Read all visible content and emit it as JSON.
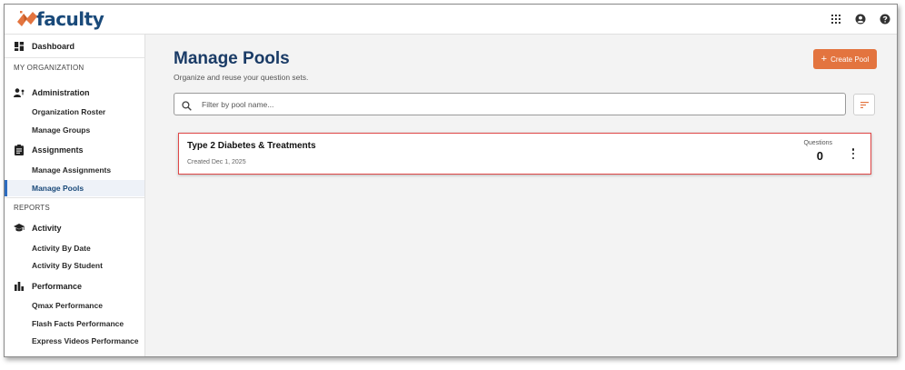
{
  "app": {
    "logo_text": "faculty"
  },
  "topbar": {
    "icons": [
      "apps-grid-icon",
      "account-circle-icon",
      "help-icon"
    ]
  },
  "sidebar": {
    "dashboard": "Dashboard",
    "my_org_section": "MY ORGANIZATION",
    "administration": "Administration",
    "admin_items": [
      "Organization Roster",
      "Manage Groups"
    ],
    "assignments": "Assignments",
    "assignment_items": [
      "Manage Assignments",
      "Manage Pools"
    ],
    "reports_section": "REPORTS",
    "activity": "Activity",
    "activity_items": [
      "Activity By Date",
      "Activity By Student"
    ],
    "performance": "Performance",
    "performance_items": [
      "Qmax Performance",
      "Flash Facts Performance",
      "Express Videos Performance"
    ]
  },
  "main": {
    "title": "Manage Pools",
    "subtitle": "Organize and reuse your question sets.",
    "create_button": "Create Pool",
    "search_placeholder": "Filter by pool name..."
  },
  "pools": [
    {
      "name": "Type 2 Diabetes & Treatments",
      "created": "Created Dec 1, 2025",
      "questions_label": "Questions",
      "questions": "0"
    }
  ],
  "colors": {
    "accent": "#e3743f",
    "brand": "#1a4a7a",
    "active": "#2d6cc0",
    "highlight": "#e04848"
  }
}
